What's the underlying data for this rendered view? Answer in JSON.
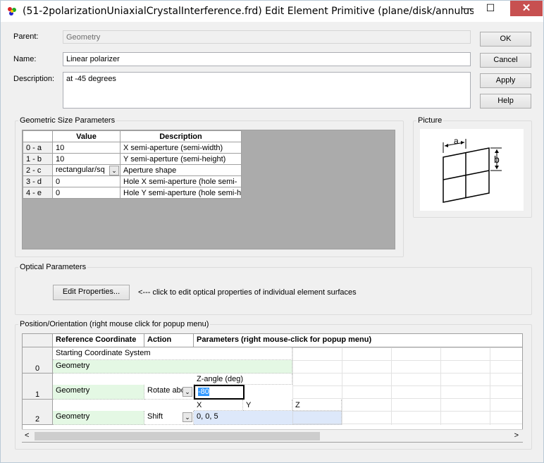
{
  "window": {
    "title": "(51-2polarizationUniaxialCrystalInterference.frd) Edit Element Primitive (plane/disk/annulus sur...",
    "minimize_glyph": "—",
    "maximize_glyph": "☐",
    "close_glyph": "✕"
  },
  "form": {
    "parent_label": "Parent:",
    "parent_value": "Geometry",
    "name_label": "Name:",
    "name_value": "Linear polarizer",
    "description_label": "Description:",
    "description_value": "at -45 degrees"
  },
  "buttons": {
    "ok": "OK",
    "cancel": "Cancel",
    "apply": "Apply",
    "help": "Help"
  },
  "geometric": {
    "group_title": "Geometric Size Parameters",
    "headers": [
      "",
      "Value",
      "Description"
    ],
    "rows": [
      {
        "id": "0 - a",
        "value": "10",
        "desc": "X semi-aperture (semi-width)"
      },
      {
        "id": "1 - b",
        "value": "10",
        "desc": "Y semi-aperture (semi-height)"
      },
      {
        "id": "2 - c",
        "value": "rectangular/sq",
        "desc": "Aperture shape"
      },
      {
        "id": "3 - d",
        "value": "0",
        "desc": "Hole X semi-aperture (hole semi-"
      },
      {
        "id": "4 - e",
        "value": "0",
        "desc": "Hole Y semi-aperture (hole semi-h"
      }
    ]
  },
  "picture": {
    "group_title": "Picture",
    "label_a": "a",
    "label_b": "b"
  },
  "optical": {
    "group_title": "Optical Parameters",
    "edit_button": "Edit Properties...",
    "hint": "<---  click to edit optical properties of individual element surfaces"
  },
  "position": {
    "group_title": "Position/Orientation  (right mouse click for popup menu)",
    "headers": {
      "ref": "Reference Coordinate",
      "action": "Action",
      "params": "Parameters (right mouse-click for popup menu)"
    },
    "rows": [
      {
        "index": "0",
        "sub": "Starting Coordinate System",
        "ref": "Geometry"
      },
      {
        "index": "1",
        "sub": "Z-angle (deg)",
        "ref": "Geometry",
        "action": "Rotate abo",
        "value": "-80"
      },
      {
        "index": "2",
        "sub_x": "X",
        "sub_y": "Y",
        "sub_z": "Z",
        "ref": "Geometry",
        "action": "Shift",
        "value": "0,  0,  5"
      }
    ],
    "scroll_left": "<",
    "scroll_right": ">"
  }
}
